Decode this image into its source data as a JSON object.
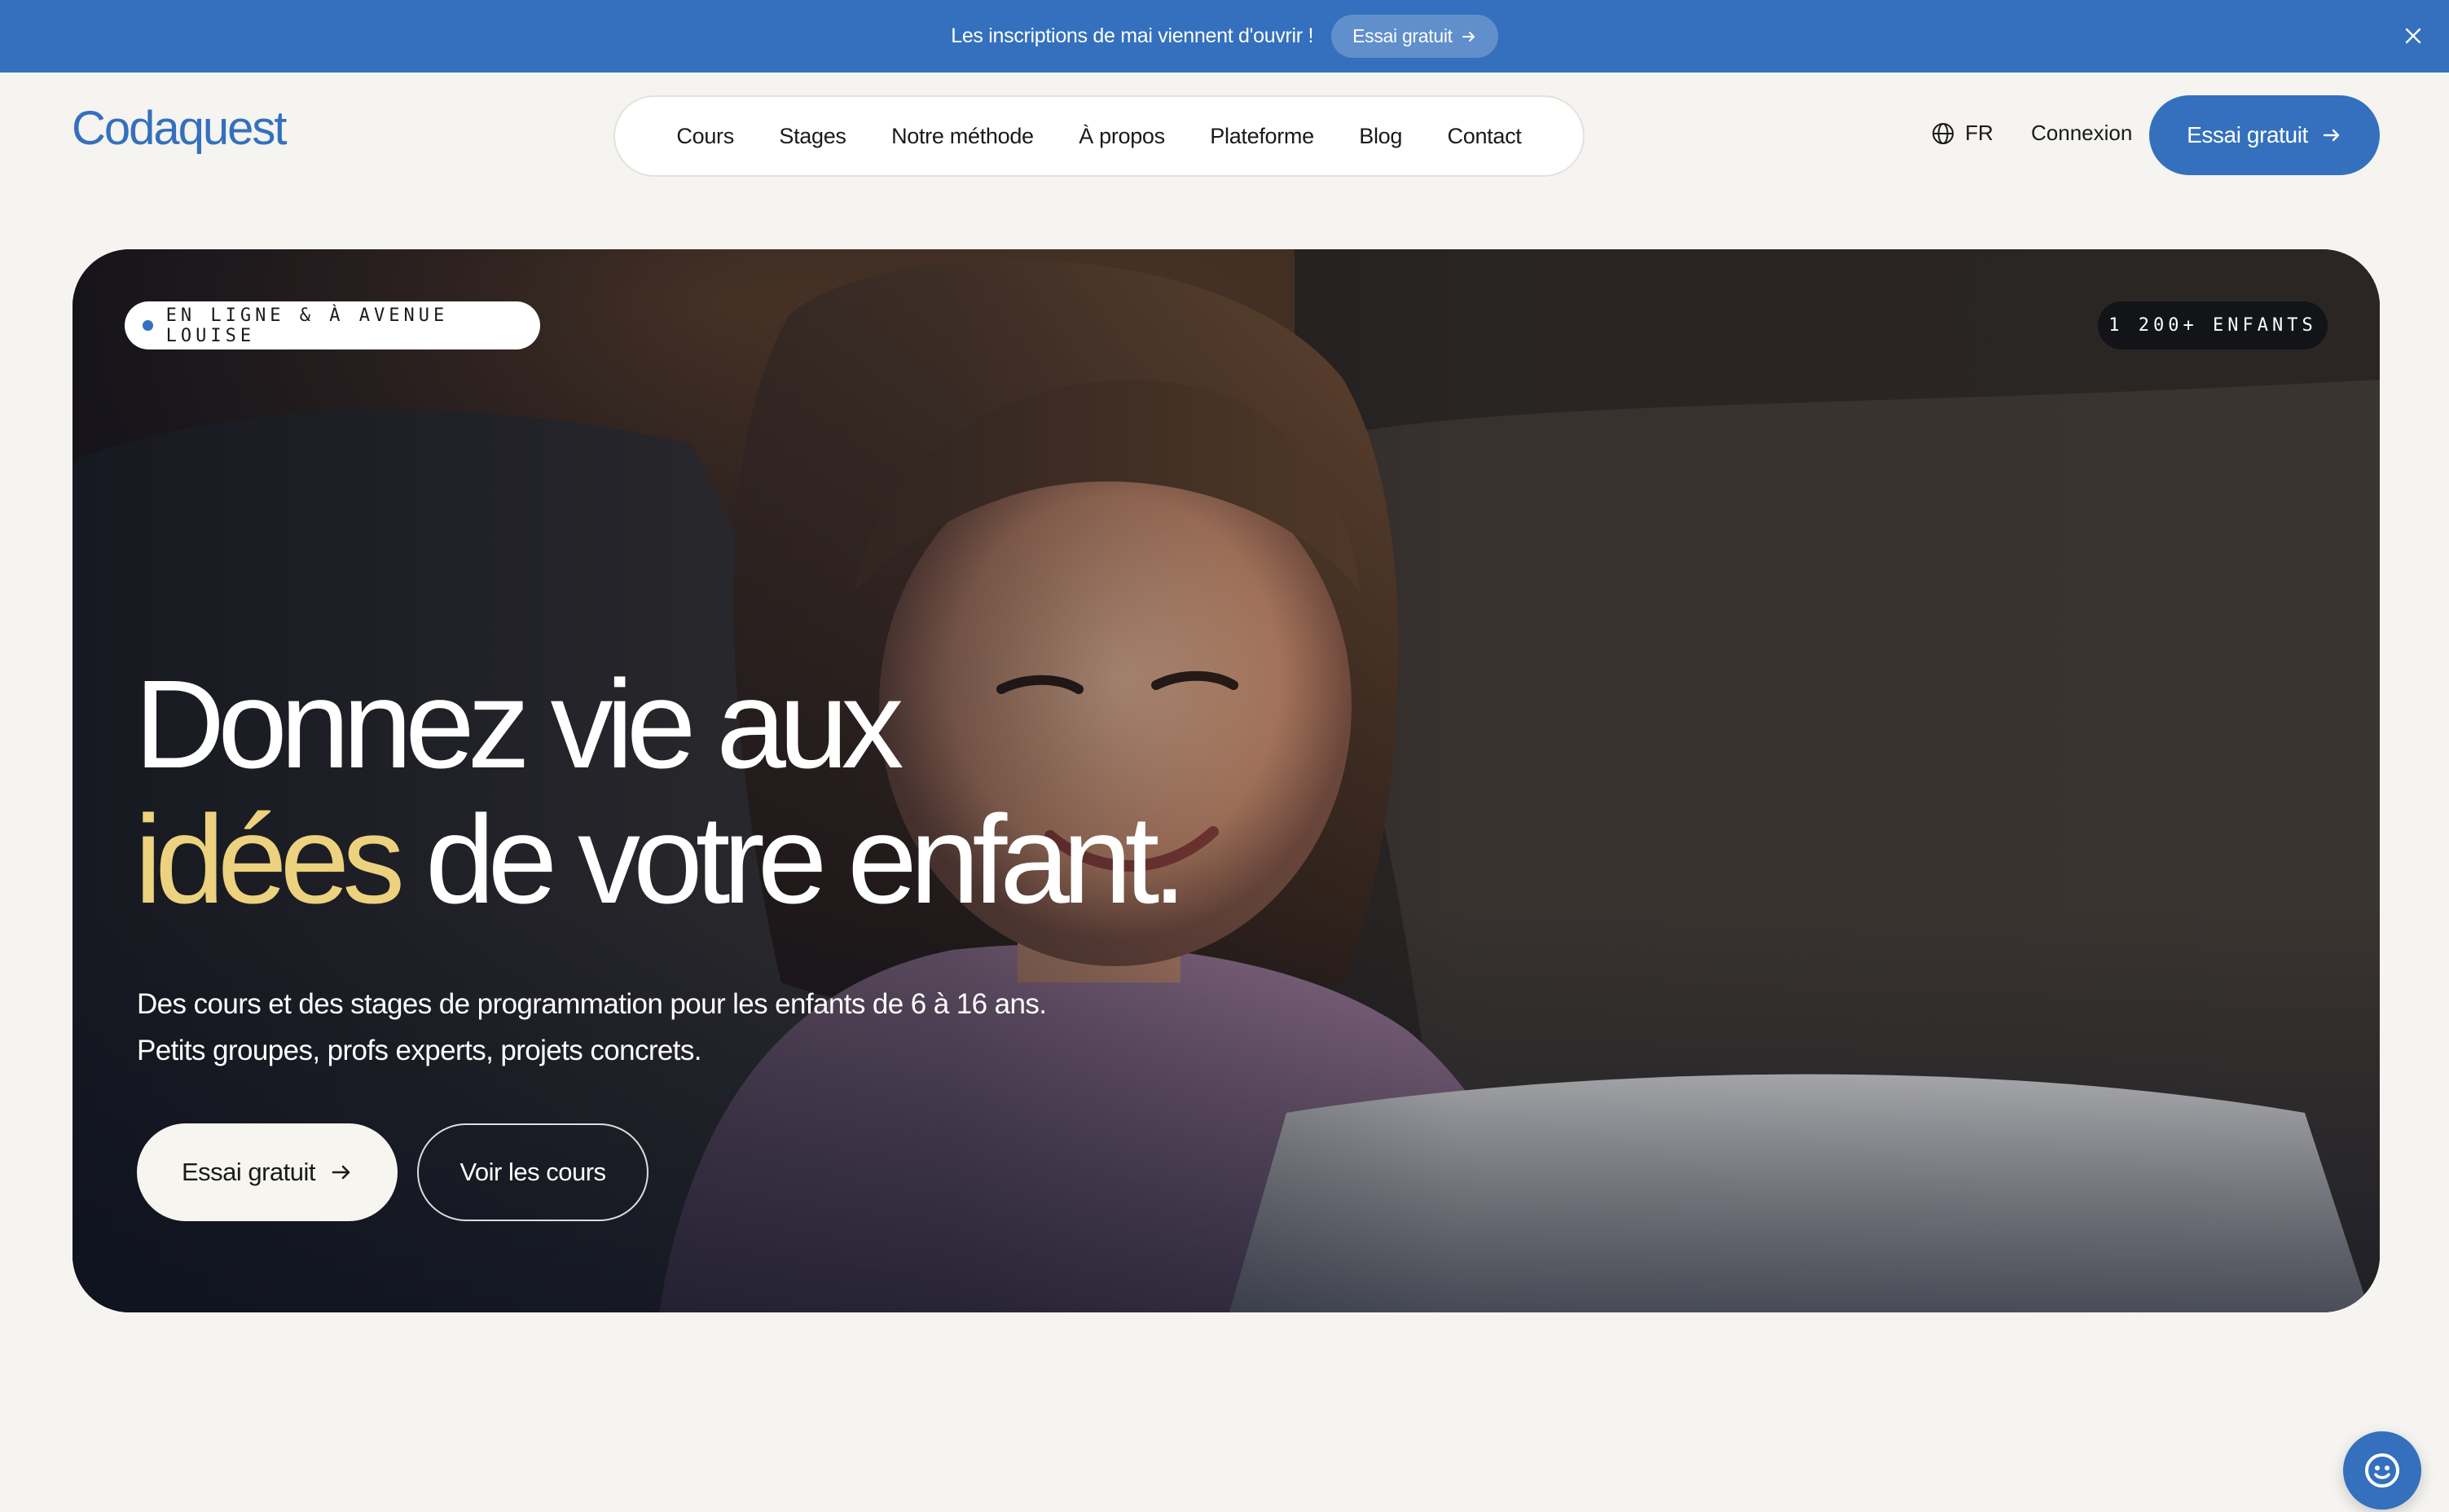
{
  "announcement": {
    "text": "Les inscriptions de mai viennent d'ouvrir !",
    "button_label": "Essai gratuit",
    "close_icon": "close-icon"
  },
  "header": {
    "logo": "Codaquest",
    "nav": [
      {
        "label": "Cours"
      },
      {
        "label": "Stages"
      },
      {
        "label": "Notre méthode"
      },
      {
        "label": "À propos"
      },
      {
        "label": "Plateforme"
      },
      {
        "label": "Blog"
      },
      {
        "label": "Contact"
      }
    ],
    "language": {
      "icon": "globe-icon",
      "label": "FR"
    },
    "login_label": "Connexion",
    "cta_label": "Essai gratuit"
  },
  "hero": {
    "badge_left": "EN LIGNE & À AVENUE LOUISE",
    "badge_right": "1 200+ ENFANTS",
    "headline_line1": "Donnez vie aux",
    "headline_accent": "idées",
    "headline_line2_rest": " de votre enfant.",
    "subtitle_line1": "Des cours et des stages de programmation pour les enfants de 6 à 16 ans.",
    "subtitle_line2": "Petits groupes, profs experts, projets concrets.",
    "primary_button": "Essai gratuit",
    "secondary_button": "Voir les cours",
    "image": "child-using-laptop-photo"
  },
  "chat_widget": {
    "icon": "chat-bot-icon"
  },
  "colors": {
    "brand_blue": "#3470bd",
    "accent_yellow": "#ecd27e",
    "page_bg": "#f5f4f0",
    "dark_pill": "#121418"
  }
}
